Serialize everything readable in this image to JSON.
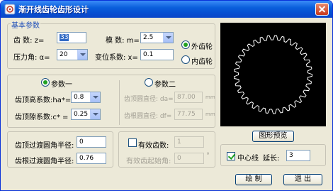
{
  "window": {
    "title": "渐开线齿轮齿形设计"
  },
  "basic": {
    "group_label": "基本参数",
    "z_label": "齿  数:  z=",
    "z_value": "33",
    "m_label": "模  数:  m=",
    "m_value": "2.5",
    "alpha_label": "压力角:  α=",
    "alpha_value": "20",
    "x_label": "变位系数:  x=",
    "x_value": "0.1",
    "external_label": "外齿轮",
    "internal_label": "内齿轮"
  },
  "param1": {
    "radio_label": "参数一",
    "ha_label": "齿顶高系数:ha*=",
    "ha_value": "0.8",
    "c_label": "齿顶隙系数:c* =",
    "c_value": "0.25"
  },
  "param2": {
    "radio_label": "参数二",
    "da_label": "齿顶圆直径:  da=",
    "da_value": "87.00",
    "da_unit": "mm",
    "df_label": "齿根圆直径:  df=",
    "df_value": "77.75",
    "df_unit": "mm"
  },
  "fillet": {
    "tip_label": "齿顶过渡圆角半径:",
    "tip_value": "0",
    "root_label": "齿根过渡圆角半径:",
    "root_value": "0.76"
  },
  "effective": {
    "check_label": "有效齿数:",
    "count_value": "1",
    "angle_label": "有效齿起始角:",
    "angle_value": "0",
    "angle_unit": "°"
  },
  "preview": {
    "button_label": "图形预览"
  },
  "options": {
    "centerline_label": "中心线",
    "extend_label": "延长:",
    "extend_value": "3"
  },
  "footer": {
    "draw_label": "绘  制",
    "exit_label": "退  出"
  },
  "colors": {
    "accent": "#0a5fdc",
    "group_label": "#1f4fb8",
    "radio_dot": "#21a121"
  }
}
